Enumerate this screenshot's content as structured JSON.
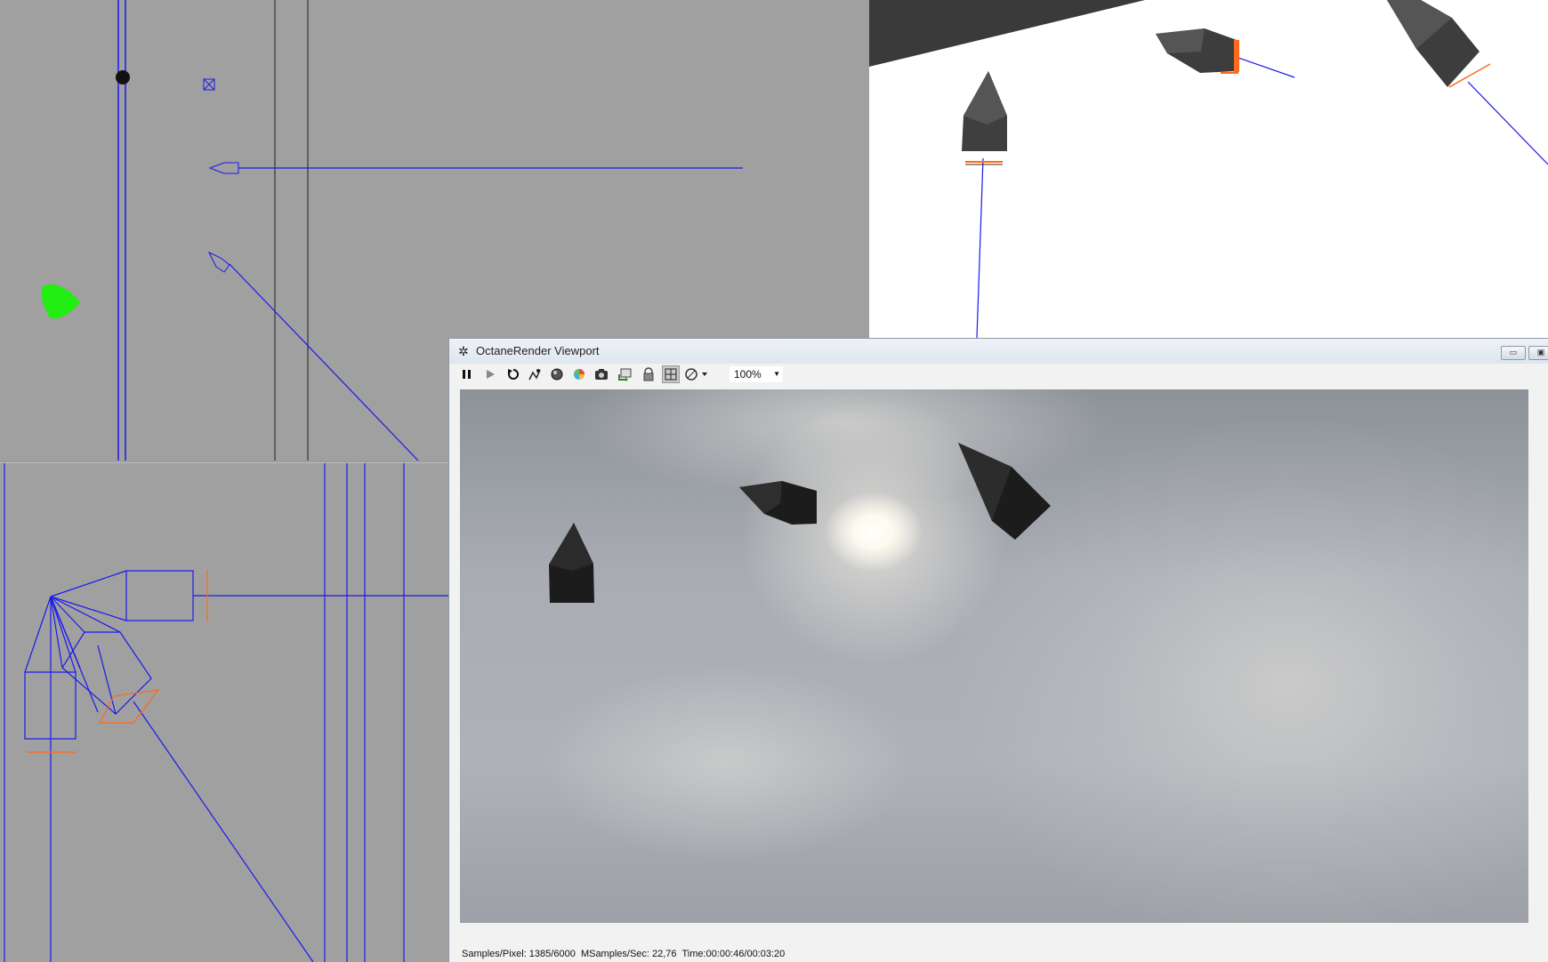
{
  "window": {
    "title": "OctaneRender Viewport",
    "title_icon": "octane-logo-icon",
    "minimize_icon": "minimize-icon",
    "maximize_icon": "maximize-icon"
  },
  "toolbar": {
    "buttons": [
      {
        "name": "pause-button",
        "icon": "pause-icon"
      },
      {
        "name": "start-button",
        "icon": "play-icon"
      },
      {
        "name": "restart-button",
        "icon": "restart-icon"
      },
      {
        "name": "recenter-button",
        "icon": "pick-focus-icon"
      },
      {
        "name": "clay-mode-button",
        "icon": "clay-render-icon"
      },
      {
        "name": "color-button",
        "icon": "color-wheel-icon"
      },
      {
        "name": "snapshot-button",
        "icon": "camera-icon"
      },
      {
        "name": "export-button",
        "icon": "export-icon"
      },
      {
        "name": "lock-button",
        "icon": "lock-icon"
      },
      {
        "name": "region-button",
        "icon": "region-render-icon"
      },
      {
        "name": "options-button",
        "icon": "settings-dropdown-icon"
      }
    ],
    "zoom": "100%"
  },
  "status": {
    "samples": "Samples/Pixel: 1385/6000",
    "msamples": "MSamples/Sec: 22,76",
    "time": "Time:00:00:46/00:03:20"
  },
  "colors": {
    "wire_blue": "#1a1aee",
    "wire_orange": "#ff6a1a",
    "light_green": "#22ee11",
    "viewport_gray": "#a0a0a0"
  }
}
